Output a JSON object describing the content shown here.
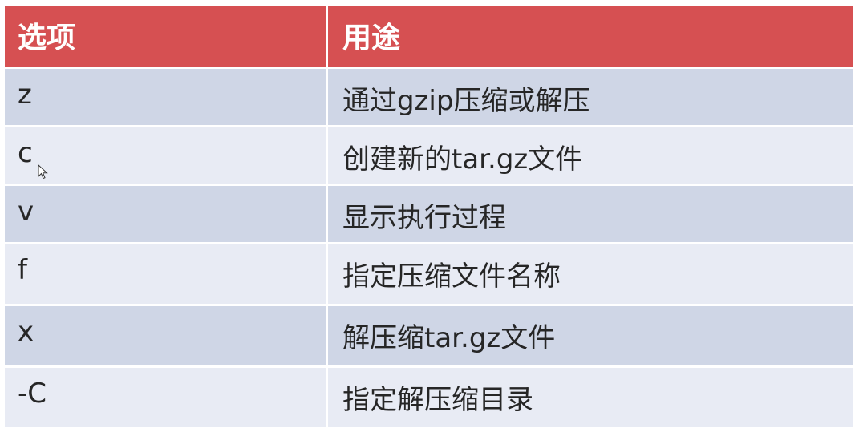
{
  "table": {
    "headers": [
      "选项",
      "用途"
    ],
    "rows": [
      {
        "option": "z",
        "usage": "通过gzip压缩或解压"
      },
      {
        "option": "c",
        "usage": "创建新的tar.gz文件"
      },
      {
        "option": "v",
        "usage": "显示执行过程"
      },
      {
        "option": "f",
        "usage": "指定压缩文件名称"
      },
      {
        "option": "x",
        "usage": "解压缩tar.gz文件"
      },
      {
        "option": "-C",
        "usage": "指定解压缩目录"
      }
    ]
  },
  "colors": {
    "header_bg": "#d65052",
    "row_dark": "#cfd6e6",
    "row_light": "#e8ebf4"
  },
  "icons": [
    "mouse-pointer-icon"
  ]
}
